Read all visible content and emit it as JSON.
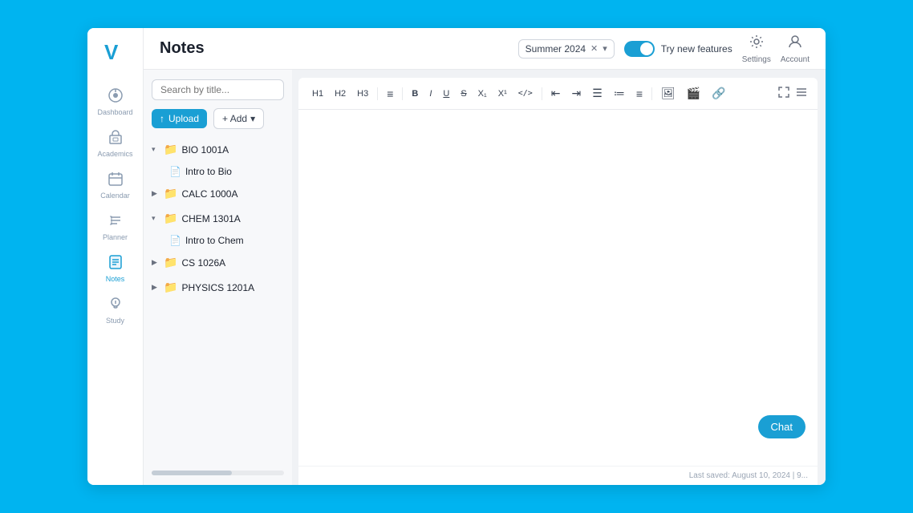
{
  "app": {
    "title": "Notes",
    "logo_text": "V"
  },
  "header": {
    "semester": "Summer 2024",
    "try_new_features": "Try new features",
    "settings_label": "Settings",
    "account_label": "Account"
  },
  "sidebar": {
    "items": [
      {
        "id": "dashboard",
        "label": "Dashboard",
        "icon": "⊙"
      },
      {
        "id": "academics",
        "label": "Academics",
        "icon": "🏛"
      },
      {
        "id": "calendar",
        "label": "Calendar",
        "icon": "📅"
      },
      {
        "id": "planner",
        "label": "Planner",
        "icon": "☰"
      },
      {
        "id": "notes",
        "label": "Notes",
        "icon": "📄"
      },
      {
        "id": "study",
        "label": "Study",
        "icon": "💡"
      }
    ]
  },
  "notes": {
    "search_placeholder": "Search by title...",
    "upload_label": "Upload",
    "add_label": "+ Add",
    "folders": [
      {
        "name": "BIO 1001A",
        "expanded": true,
        "children": [
          {
            "name": "Intro to Bio"
          }
        ]
      },
      {
        "name": "CALC 1000A",
        "expanded": false,
        "children": []
      },
      {
        "name": "CHEM 1301A",
        "expanded": true,
        "children": [
          {
            "name": "Intro to Chem"
          }
        ]
      },
      {
        "name": "CS 1026A",
        "expanded": false,
        "children": []
      },
      {
        "name": "PHYSICS 1201A",
        "expanded": false,
        "children": []
      }
    ]
  },
  "toolbar": {
    "h1": "H1",
    "h2": "H2",
    "h3": "H3",
    "bullet": "≡",
    "bold": "B",
    "italic": "I",
    "underline": "U",
    "strikethrough": "S",
    "subscript": "X₁",
    "superscript": "X¹",
    "code": "</>",
    "indent_left": "⇤",
    "indent_right": "⇥",
    "bullet_list": "☰",
    "ordered_list": "≔",
    "align": "≡",
    "image": "🖼",
    "video": "🎬",
    "link": "🔗"
  },
  "editor": {
    "last_saved": "Last saved: August 10, 2024 | 9..."
  },
  "chat": {
    "label": "Chat"
  }
}
